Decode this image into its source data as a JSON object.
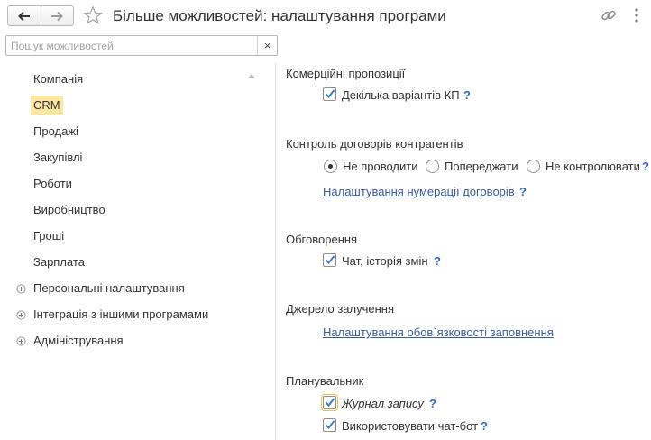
{
  "header": {
    "title": "Більше можливостей: налаштування програми",
    "back_icon": "arrow-left-icon",
    "forward_icon": "arrow-right-icon",
    "favorite_icon": "star-icon",
    "link_icon": "link-icon",
    "more_icon": "more-vertical-icon"
  },
  "search": {
    "placeholder": "Пошук можливостей",
    "value": "",
    "clear_label": "×"
  },
  "sidebar": {
    "items": [
      {
        "label": "Компанія",
        "expandable": false
      },
      {
        "label": "CRM",
        "expandable": false,
        "selected": true
      },
      {
        "label": "Продажі",
        "expandable": false
      },
      {
        "label": "Закупівлі",
        "expandable": false
      },
      {
        "label": "Роботи",
        "expandable": false
      },
      {
        "label": "Виробництво",
        "expandable": false
      },
      {
        "label": "Гроші",
        "expandable": false
      },
      {
        "label": "Зарплата",
        "expandable": false
      },
      {
        "label": "Персональні налаштування",
        "expandable": true
      },
      {
        "label": "Інтеграція з іншими програмами",
        "expandable": true
      },
      {
        "label": "Адміністрування",
        "expandable": true
      }
    ]
  },
  "main": {
    "commercial": {
      "title": "Комерційні пропозиції",
      "multi_variants": {
        "label": "Декілька варіантів КП",
        "checked": true,
        "help": "?"
      }
    },
    "contracts": {
      "title": "Контроль договорів контрагентів",
      "options": [
        {
          "label": "Не проводити",
          "selected": true
        },
        {
          "label": "Попереджати",
          "selected": false
        },
        {
          "label": "Не контролювати",
          "selected": false
        }
      ],
      "help": "?",
      "numbering_link": "Налаштування нумерації договорів",
      "numbering_help": "?"
    },
    "discussion": {
      "title": "Обговорення",
      "chat_history": {
        "label": "Чат, історія змін",
        "checked": true,
        "help": "?"
      }
    },
    "source": {
      "title": "Джерело залучення",
      "required_link": "Налаштування обов`язковості заповнення"
    },
    "planner": {
      "title": "Планувальник",
      "journal": {
        "label": "Журнал запису",
        "checked": true,
        "help": "?"
      },
      "chatbot": {
        "label": "Використовувати чат-бот",
        "checked": true,
        "help": "?"
      }
    }
  },
  "colors": {
    "selected_bg": "#fbe7a3",
    "link": "#3a5ba0",
    "help": "#3366cc",
    "check": "#3d7fc7",
    "focus": "#f1c24b"
  }
}
